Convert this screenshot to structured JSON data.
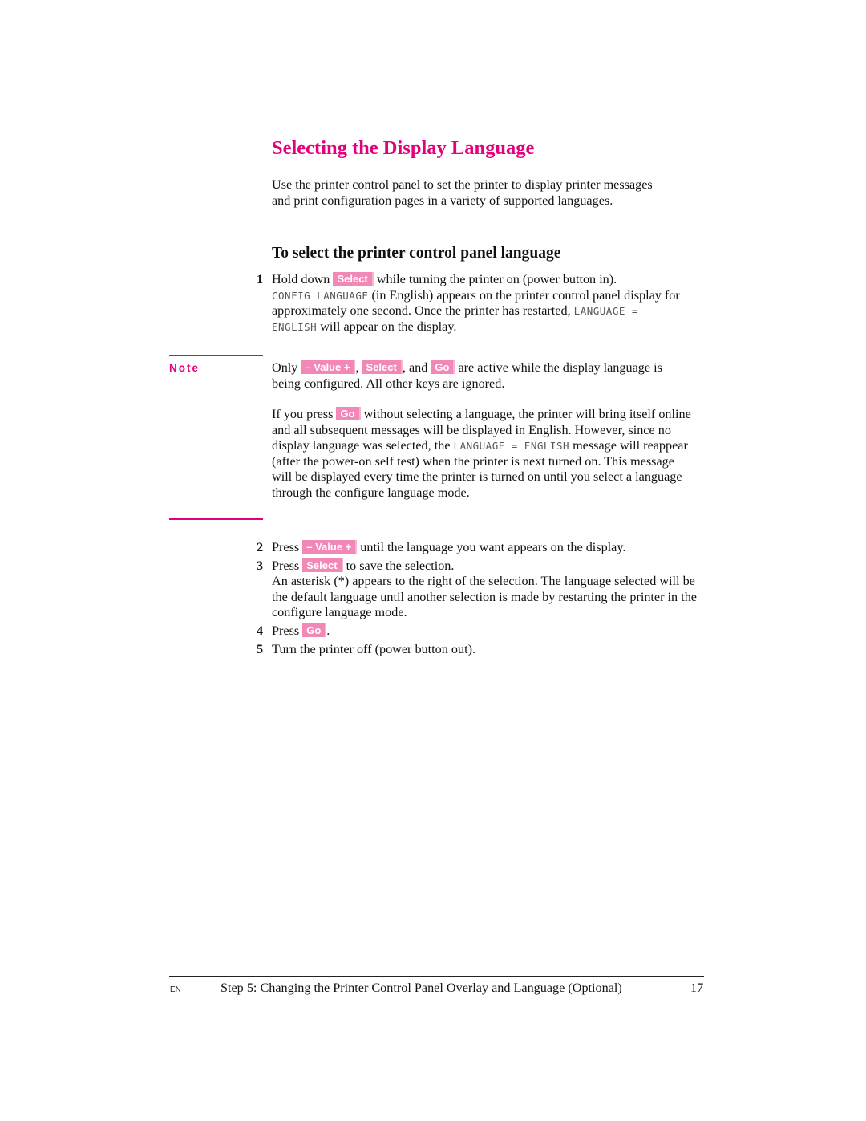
{
  "page": {
    "title": "Selecting the Display Language",
    "intro": "Use the printer control panel to set the printer to display printer messages and print configuration pages in a variety of supported languages.",
    "subheading": "To select the printer control panel language",
    "keys": {
      "select": "Select",
      "value": "– Value +",
      "go": "Go"
    },
    "colors": {
      "accent": "#e4007c",
      "key_background": "#f288b7"
    },
    "step1": {
      "number": "1",
      "t1": "Hold down ",
      "t2": " while turning the printer on (power button in).",
      "lcd1": "CONFIG LANGUAGE",
      "t3": " (in English) appears on the printer control panel display for approximately one second. Once the printer has restarted, ",
      "lcd2": "LANGUAGE = ENGLISH",
      "t4": " will appear on the display."
    },
    "note": {
      "label": "Note",
      "p1": {
        "t1": "Only ",
        "t2": ", ",
        "t3": ", and ",
        "t4": " are active while the display language is being configured. All other keys are ignored."
      },
      "p2": {
        "t1": "If you press ",
        "t2": " without selecting a language, the printer will bring itself online and all subsequent messages will be displayed in English. However, since no display language was selected, the ",
        "lcd": "LANGUAGE = ENGLISH",
        "t3": " message will reappear (after the power-on self test) when the printer is next turned on. This message will be displayed every time the printer is turned on until you select a language through the configure language mode."
      }
    },
    "step2": {
      "number": "2",
      "t1": "Press ",
      "t2": " until the language you want appears on the display."
    },
    "step3": {
      "number": "3",
      "t1": "Press ",
      "t2": " to save the selection.",
      "detail": "An asterisk (*) appears to the right of the selection. The language selected will be the default language until another selection is made by restarting the printer in the configure language mode."
    },
    "step4": {
      "number": "4",
      "t1": "Press ",
      "t2": "."
    },
    "step5": {
      "number": "5",
      "t1": "Turn the printer off (power button out)."
    },
    "footer": {
      "lang": "EN",
      "text": "Step 5: Changing the Printer Control Panel Overlay and Language (Optional)",
      "page_number": "17"
    }
  }
}
